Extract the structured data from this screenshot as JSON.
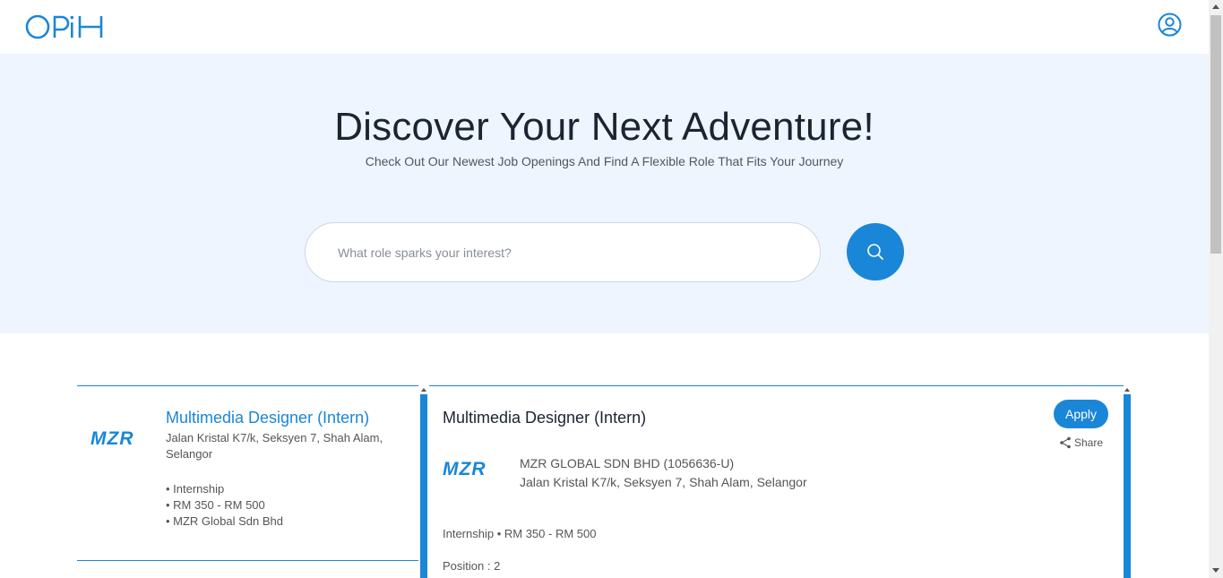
{
  "header": {
    "logo_text": "OPiH",
    "profile_icon": "user-circle-icon"
  },
  "hero": {
    "title": "Discover Your Next Adventure!",
    "subtitle": "Check Out Our Newest Job Openings And Find A Flexible Role That Fits Your Journey",
    "search_placeholder": "What role sparks your interest?",
    "search_icon": "search-icon"
  },
  "job_list": [
    {
      "logo_text": "MZR",
      "title": "Multimedia Designer (Intern)",
      "address": "Jalan Kristal K7/k, Seksyen 7, Shah Alam, Selangor",
      "meta": [
        "• Internship",
        "• RM 350 - RM 500",
        "• MZR Global Sdn Bhd"
      ]
    }
  ],
  "detail": {
    "title": "Multimedia Designer (Intern)",
    "apply_label": "Apply",
    "share_label": "Share",
    "logo_text": "MZR",
    "company_name": "MZR GLOBAL SDN BHD (1056636-U)",
    "company_address": "Jalan Kristal K7/k, Seksyen 7, Shah Alam, Selangor",
    "meta": "Internship  • RM 350 - RM 500",
    "positions": "Position : 2"
  },
  "colors": {
    "accent": "#1a86d8",
    "hero_bg": "#eef5fe",
    "text_dark": "#1b2433"
  }
}
